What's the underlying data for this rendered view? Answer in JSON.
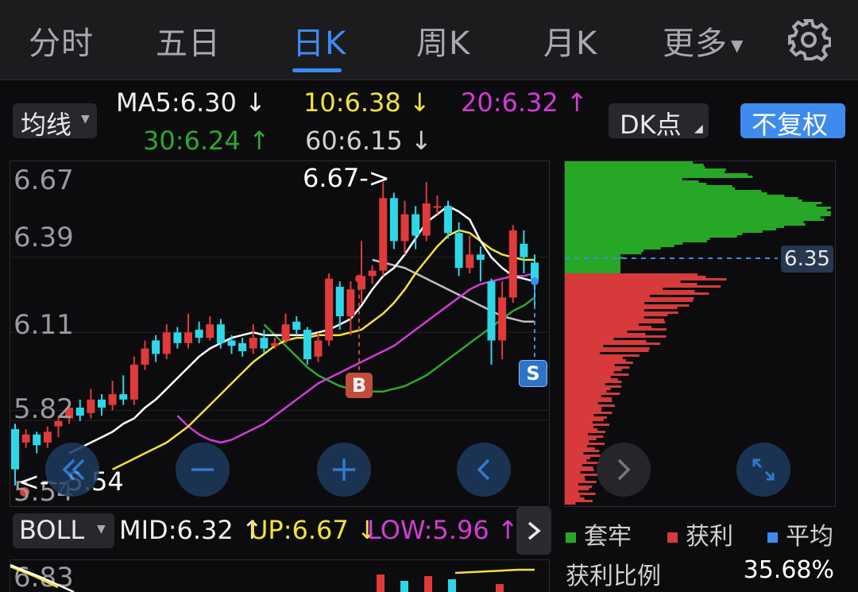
{
  "tabs": [
    {
      "label": "分时"
    },
    {
      "label": "五日"
    },
    {
      "label": "日K"
    },
    {
      "label": "周K"
    },
    {
      "label": "月K"
    },
    {
      "label": "更多"
    }
  ],
  "active_tab": "日K",
  "indicator_bar": {
    "ma_selector": "均线",
    "ma5": "MA5:6.30",
    "ma10": "10:6.38",
    "ma20": "20:6.32",
    "ma30": "30:6.24",
    "ma60": "60:6.15",
    "dk_button": "DK点",
    "adjust_button": "不复权"
  },
  "colors": {
    "accent": "#3e8bf0",
    "up_red": "#e03a3a",
    "down_cyan": "#2fd6e8",
    "ma5_white": "#ffffff",
    "ma10_yellow": "#f2e23c",
    "ma20_magenta": "#d43bd6",
    "ma30_green": "#2ea82e",
    "ma60_gray": "#c0c0c0",
    "chip_green": "#26a826",
    "chip_red": "#d63a3a"
  },
  "price_axis": [
    "6.67",
    "6.39",
    "6.11",
    "5.82",
    "5.54"
  ],
  "annotations": {
    "high_label": "6.67->",
    "low_label": "<---5.54",
    "buy_marker": "B",
    "sell_marker": "S"
  },
  "chip_panel": {
    "avg_price": "6.35",
    "legend_trapped": "套牢",
    "legend_profit": "获利",
    "legend_avg": "平均",
    "profit_ratio_label": "获利比例",
    "profit_ratio_value": "35.68%"
  },
  "boll_bar": {
    "selector": "BOLL",
    "mid": "MID:6.32",
    "up": "UP:6.67",
    "low": "LOW:5.96",
    "lower_axis_top": "6.83"
  },
  "chart_data": {
    "type": "candlestick",
    "ylim": [
      5.54,
      6.67
    ],
    "yticks": [
      6.67,
      6.39,
      6.11,
      5.82,
      5.54
    ],
    "candles": [
      [
        5.75,
        5.6,
        5.77,
        5.54
      ],
      [
        5.7,
        5.73,
        5.75,
        5.68
      ],
      [
        5.73,
        5.69,
        5.74,
        5.66
      ],
      [
        5.7,
        5.74,
        5.76,
        5.68
      ],
      [
        5.76,
        5.78,
        5.8,
        5.72
      ],
      [
        5.79,
        5.83,
        5.85,
        5.77
      ],
      [
        5.83,
        5.8,
        5.86,
        5.78
      ],
      [
        5.81,
        5.86,
        5.9,
        5.79
      ],
      [
        5.86,
        5.83,
        5.88,
        5.8
      ],
      [
        5.84,
        5.88,
        5.93,
        5.82
      ],
      [
        5.88,
        5.86,
        5.95,
        5.84
      ],
      [
        5.86,
        5.99,
        6.02,
        5.84
      ],
      [
        5.99,
        6.05,
        6.08,
        5.97
      ],
      [
        6.08,
        6.03,
        6.1,
        6.0
      ],
      [
        6.03,
        6.11,
        6.14,
        6.01
      ],
      [
        6.11,
        6.07,
        6.13,
        6.05
      ],
      [
        6.07,
        6.11,
        6.18,
        6.05
      ],
      [
        6.12,
        6.09,
        6.15,
        6.07
      ],
      [
        6.09,
        6.14,
        6.17,
        6.08
      ],
      [
        6.14,
        6.07,
        6.16,
        6.05
      ],
      [
        6.08,
        6.06,
        6.1,
        6.03
      ],
      [
        6.07,
        6.04,
        6.09,
        6.02
      ],
      [
        6.05,
        6.09,
        6.14,
        6.03
      ],
      [
        6.09,
        6.05,
        6.12,
        6.03
      ],
      [
        6.06,
        6.07,
        6.09,
        6.05
      ],
      [
        6.08,
        6.14,
        6.18,
        6.07
      ],
      [
        6.15,
        6.12,
        6.17,
        6.1
      ],
      [
        6.12,
        6.01,
        6.13,
        5.99
      ],
      [
        6.02,
        6.08,
        6.11,
        6.0
      ],
      [
        6.08,
        6.31,
        6.33,
        6.06
      ],
      [
        6.28,
        6.17,
        6.3,
        6.12
      ],
      [
        6.17,
        6.27,
        6.3,
        6.1
      ],
      [
        6.27,
        6.32,
        6.45,
        6.22
      ],
      [
        6.32,
        6.34,
        6.36,
        6.29
      ],
      [
        6.34,
        6.61,
        6.67,
        6.32
      ],
      [
        6.61,
        6.45,
        6.63,
        6.42
      ],
      [
        6.45,
        6.55,
        6.6,
        6.4
      ],
      [
        6.55,
        6.47,
        6.58,
        6.42
      ],
      [
        6.47,
        6.59,
        6.67,
        6.45
      ],
      [
        6.58,
        6.58,
        6.62,
        6.55
      ],
      [
        6.58,
        6.48,
        6.6,
        6.46
      ],
      [
        6.48,
        6.35,
        6.52,
        6.32
      ],
      [
        6.35,
        6.4,
        6.47,
        6.33
      ],
      [
        6.4,
        6.38,
        6.43,
        6.3
      ],
      [
        6.3,
        6.08,
        6.31,
        5.99
      ],
      [
        6.08,
        6.24,
        6.3,
        6.01
      ],
      [
        6.24,
        6.49,
        6.51,
        6.22
      ],
      [
        6.44,
        6.39,
        6.49,
        6.33
      ],
      [
        6.37,
        6.3,
        6.4,
        6.2
      ]
    ],
    "ma5": [
      5.66,
      5.68,
      5.7,
      5.72,
      5.74,
      5.77,
      5.79,
      5.83,
      5.86,
      5.9,
      5.94,
      5.98,
      6.02,
      6.05,
      6.07,
      6.09,
      6.1,
      6.11,
      6.1,
      6.1,
      6.1,
      6.1,
      6.1,
      6.11,
      6.12,
      6.14,
      6.16,
      6.21,
      6.27,
      6.32,
      6.35,
      6.4,
      6.46,
      6.52,
      6.55,
      6.58,
      6.56,
      6.53,
      6.45,
      6.39,
      6.35,
      6.32,
      6.31,
      6.3
    ],
    "ma10": [
      5.6,
      5.62,
      5.64,
      5.66,
      5.68,
      5.7,
      5.73,
      5.76,
      5.8,
      5.84,
      5.88,
      5.92,
      5.96,
      6.0,
      6.03,
      6.06,
      6.08,
      6.09,
      6.09,
      6.1,
      6.1,
      6.1,
      6.11,
      6.12,
      6.15,
      6.18,
      6.22,
      6.27,
      6.33,
      6.38,
      6.43,
      6.47,
      6.49,
      6.48,
      6.45,
      6.42,
      6.4,
      6.39,
      6.38,
      6.38
    ],
    "ma20": [
      5.8,
      5.76,
      5.73,
      5.71,
      5.7,
      5.71,
      5.73,
      5.75,
      5.77,
      5.8,
      5.83,
      5.86,
      5.89,
      5.92,
      5.94,
      5.96,
      5.98,
      6.0,
      6.02,
      6.04,
      6.06,
      6.09,
      6.12,
      6.15,
      6.18,
      6.21,
      6.24,
      6.27,
      6.29,
      6.3,
      6.31,
      6.32,
      6.32,
      6.33
    ],
    "ma30": [
      6.14,
      6.1,
      6.06,
      6.02,
      5.98,
      5.95,
      5.93,
      5.91,
      5.9,
      5.89,
      5.89,
      5.89,
      5.9,
      5.91,
      5.93,
      5.95,
      5.98,
      6.01,
      6.04,
      6.07,
      6.1,
      6.13,
      6.16,
      6.19,
      6.21,
      6.24
    ],
    "ma60": [
      6.38,
      6.37,
      6.36,
      6.35,
      6.33,
      6.31,
      6.29,
      6.27,
      6.25,
      6.23,
      6.21,
      6.19,
      6.17,
      6.16,
      6.15,
      6.15
    ]
  }
}
